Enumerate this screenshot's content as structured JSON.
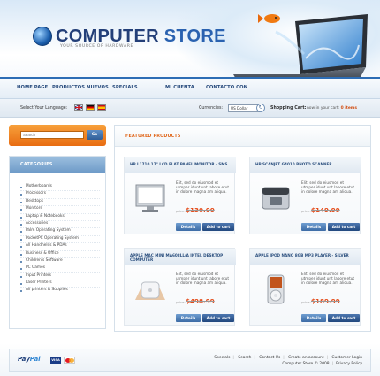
{
  "header": {
    "logo": {
      "word1": "COMPUTER",
      "word2": "STORE",
      "tagline": "YOUR SOURCE OF HARDWARE"
    },
    "nav": [
      "HOME PAGE",
      "PRODUCTOS NUEVOS",
      "SPECIALS",
      "MI CUENTA",
      "CONTACTO CON"
    ]
  },
  "toolbar": {
    "language_label": "Select Your Language:",
    "flags": [
      "uk-flag-icon",
      "de-flag-icon",
      "es-flag-icon"
    ],
    "currency_label": "Currencies:",
    "currency_value": "US Dollar",
    "cart_label": "Shopping Cart:",
    "cart_text": "now in your cart",
    "cart_count": "0 items"
  },
  "sidebar": {
    "search_placeholder": "Search",
    "search_button": "Go",
    "categories_title": "CATEGORIES",
    "categories": [
      "Motherboards",
      "Processors",
      "Desktops",
      "Monitors",
      "Laptop & Notebooks",
      "Accessories",
      "Palm Operating System",
      "PocketPC Operating System",
      "All Handhelds & PDAs",
      "Business & Office",
      "Children's Software",
      "PC Games",
      "Input Printers",
      "Laser Printers",
      "All printers & Supplies"
    ]
  },
  "main": {
    "title": "FEATURED PRODUCTS",
    "products": [
      {
        "title": "HP L1710 17\" LCD FLAT PANEL MONITOR - SMS",
        "desc": "Elit, sed do eiusmod et utmper idunt unt labore etut in dolore magna am aliqua.",
        "price_label": "price:",
        "price": "$130.00",
        "details": "Details",
        "add": "Add to cart",
        "icon": "monitor-icon"
      },
      {
        "title": "HP SCANJET G4010 PHOTO SCANNER",
        "desc": "Elit, sed do eiusmod et utmper idunt unt labore etut in dolore magna am aliqua.",
        "price_label": "price:",
        "price": "$149.99",
        "details": "Details",
        "add": "Add to cart",
        "icon": "scanner-icon"
      },
      {
        "title": "APPLE MAC MINI MA608LL/A INTEL DESKTOP COMPUTER",
        "desc": "Elit, sed do eiusmod et utmper idunt unt labore etut in dolore magna am aliqua.",
        "price_label": "price:",
        "price": "$498.99",
        "details": "Details",
        "add": "Add to cart",
        "icon": "mac-mini-icon"
      },
      {
        "title": "APPLE IPOD NANO 8GB MP3 PLAYER - SILVER",
        "desc": "Elit, sed do eiusmod et utmper idunt unt labore etut in dolore magna am aliqua.",
        "price_label": "price:",
        "price": "$189.99",
        "details": "Details",
        "add": "Add to cart",
        "icon": "ipod-icon"
      }
    ]
  },
  "footer": {
    "paypal": {
      "pay": "Pay",
      "pal": "Pal"
    },
    "visa": "VISA",
    "links": [
      "Specials",
      "Search",
      "Contact Us",
      "Create an account",
      "Customer Login"
    ],
    "copyright": "Computer Store © 2008",
    "privacy": "Privacy Policy"
  }
}
